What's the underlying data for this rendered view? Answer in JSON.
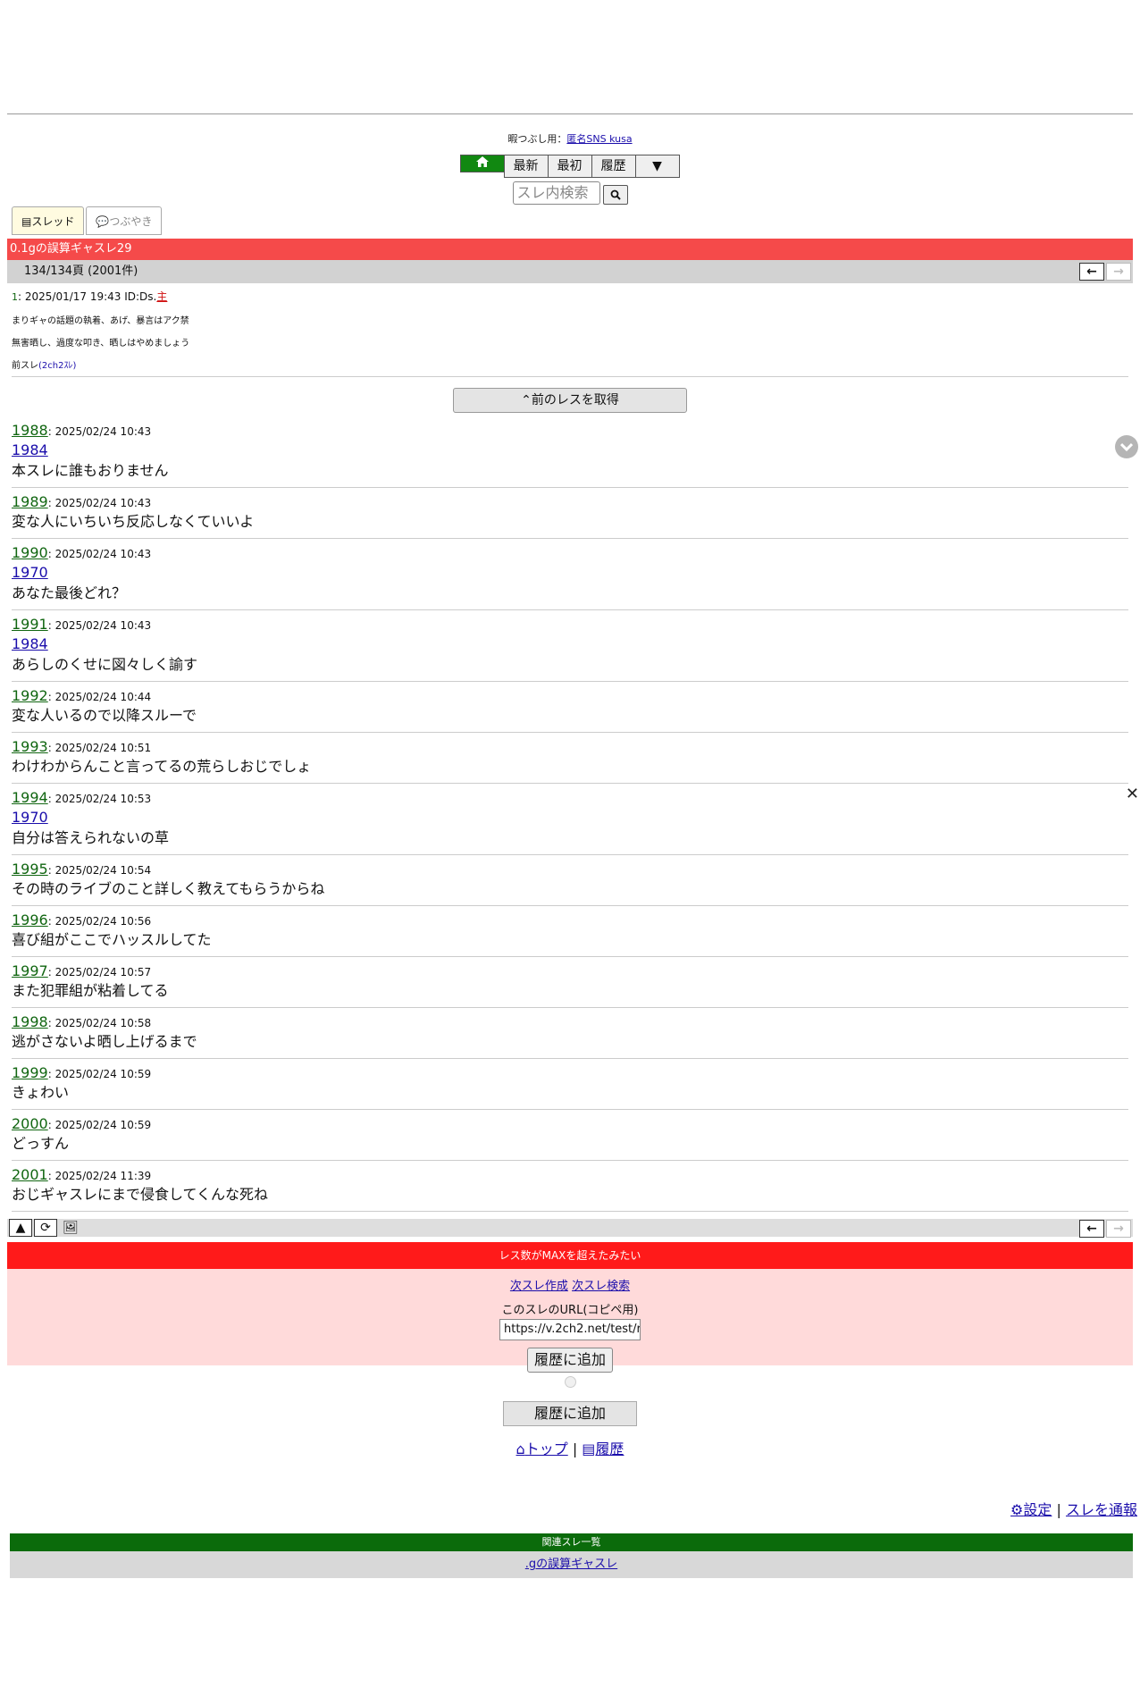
{
  "promo": {
    "prefix": "暇つぶし用：",
    "link": "匿名SNS kusa"
  },
  "nav": {
    "latest": "最新",
    "first": "最初",
    "history": "履歴",
    "more": "▼"
  },
  "search": {
    "placeholder": "スレ内検索"
  },
  "tabs": {
    "thread": "スレッド",
    "tweet": "つぶやき"
  },
  "thread": {
    "title": "0.1gの誤算ギャスレ29",
    "pages": "134/134頁 (2001件)"
  },
  "op": {
    "num": "1",
    "meta": ": 2025/01/17 19:43 ID:Ds.",
    "owner": "主",
    "lines": [
      "まりギャの話題の執着、あげ、暴言はアク禁",
      "無害晒し、過度な叩き、晒しはやめましょう"
    ],
    "prev_label": "前スレ",
    "prev_link": "(2ch2ｽﾚ)"
  },
  "prev_button": "前のレスを取得",
  "posts": [
    {
      "num": "1988",
      "date": ": 2025/02/24 10:43",
      "ref": "1984",
      "body": "本スレに誰もおりません"
    },
    {
      "num": "1989",
      "date": ": 2025/02/24 10:43",
      "ref": "",
      "body": "変な人にいちいち反応しなくていいよ"
    },
    {
      "num": "1990",
      "date": ": 2025/02/24 10:43",
      "ref": "1970",
      "body": "あなた最後どれ？"
    },
    {
      "num": "1991",
      "date": ": 2025/02/24 10:43",
      "ref": "1984",
      "body": "あらしのくせに図々しく諭す"
    },
    {
      "num": "1992",
      "date": ": 2025/02/24 10:44",
      "ref": "",
      "body": "変な人いるので以降スルーで"
    },
    {
      "num": "1993",
      "date": ": 2025/02/24 10:51",
      "ref": "",
      "body": "わけわからんこと言ってるの荒らしおじでしょ"
    },
    {
      "num": "1994",
      "date": ": 2025/02/24 10:53",
      "ref": "1970",
      "body": "自分は答えられないの草"
    },
    {
      "num": "1995",
      "date": ": 2025/02/24 10:54",
      "ref": "",
      "body": "その時のライブのこと詳しく教えてもらうからね"
    },
    {
      "num": "1996",
      "date": ": 2025/02/24 10:56",
      "ref": "",
      "body": "喜び組がここでハッスルしてた"
    },
    {
      "num": "1997",
      "date": ": 2025/02/24 10:57",
      "ref": "",
      "body": "また犯罪組が粘着してる"
    },
    {
      "num": "1998",
      "date": ": 2025/02/24 10:58",
      "ref": "",
      "body": "逃がさないよ晒し上げるまで"
    },
    {
      "num": "1999",
      "date": ": 2025/02/24 10:59",
      "ref": "",
      "body": "きょわい"
    },
    {
      "num": "2000",
      "date": ": 2025/02/24 10:59",
      "ref": "",
      "body": "どっすん"
    },
    {
      "num": "2001",
      "date": ": 2025/02/24 11:39",
      "ref": "",
      "body": "おじギャスレにまで侵食してくんな死ね"
    }
  ],
  "max_notice": {
    "banner": "レス数がMAXを超えたみたい",
    "create_next": "次スレ作成",
    "search_next": "次スレ検索",
    "url_label": "このスレのURL(コピペ用)",
    "url_value": "https://v.2ch2.net/test/r",
    "add_history": "履歴に追加"
  },
  "add_history2": "履歴に追加",
  "footer": {
    "top": "トップ",
    "sep": "|",
    "history": "履歴"
  },
  "settings": {
    "settings": "設定",
    "sep": "|",
    "report": "スレを通報"
  },
  "related": {
    "header": "関連スレ一覧",
    "items": [
      ".gの誤算ギャスレ"
    ]
  },
  "colors": {
    "title_bar": "#f54a4a",
    "max_bar": "#ff1a1a",
    "related_bar": "#0b6b0b",
    "post_number": "#116611",
    "link": "#1a0dab"
  }
}
